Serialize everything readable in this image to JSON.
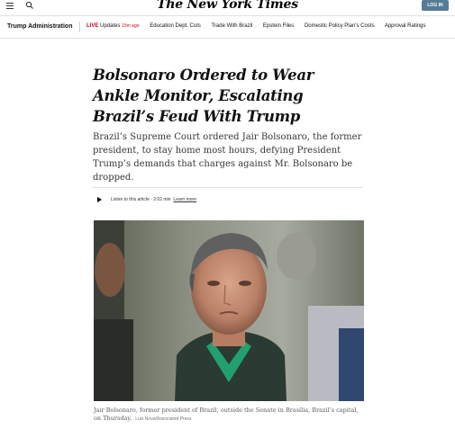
{
  "header": {
    "masthead": "The New York Times",
    "login_label": "LOG IN"
  },
  "nav": {
    "section": "Trump Administration",
    "live_label": "LIVE",
    "live_text": "Updates",
    "live_ago": "15m ago",
    "items": [
      "Education Dept. Cuts",
      "Trade With Brazil",
      "Epstein Files",
      "Domestic Policy Plan's Costs",
      "Approval Ratings"
    ]
  },
  "article": {
    "headline": "Bolsonaro Ordered to Wear Ankle Monitor, Escalating Brazil’s Feud With Trump",
    "summary": "Brazil’s Supreme Court ordered Jair Bolsonaro, the former president, to stay home most hours, defying President Trump’s demands that charges against Mr. Bolsonaro be dropped.",
    "audio_label": "Listen to this article · 2:02 min",
    "learn_more": "Learn more",
    "caption": "Jair Bolsonaro, former president of Brazil, outside the Senate in Brasília, Brazil’s capital, on Thursday.",
    "credit": "Luis Nova/Associated Press"
  }
}
